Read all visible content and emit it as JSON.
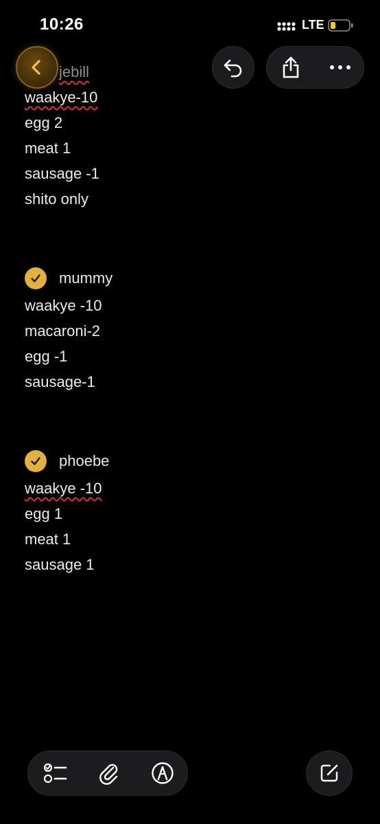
{
  "status_bar": {
    "time": "10:26",
    "network": "LTE"
  },
  "colors": {
    "background": "#000000",
    "accent": "#e3b23c",
    "toolbar_button": "#1c1c1e",
    "spellcheck_underline": "#d2343c"
  },
  "toolbar": {
    "back_icon": "chevron-left-icon",
    "undo_icon": "undo-arrow-icon",
    "share_icon": "share-icon",
    "more_icon": "ellipsis-icon"
  },
  "note": {
    "entries": [
      {
        "name": "jebill",
        "lines": [
          "waakye-10",
          "egg 2",
          "meat 1",
          "sausage -1",
          "shito only"
        ]
      },
      {
        "name": "mummy",
        "checked": true,
        "lines": [
          "waakye -10",
          "macaroni-2",
          "egg -1",
          "sausage-1"
        ]
      },
      {
        "name": "phoebe",
        "checked": true,
        "lines": [
          "waakye -10",
          "egg 1",
          "meat 1",
          "sausage 1"
        ]
      }
    ]
  },
  "bottom_toolbar": {
    "checklist_icon": "checklist-icon",
    "attachment_icon": "paperclip-icon",
    "markup_icon": "pen-circle-icon",
    "compose_icon": "compose-icon"
  }
}
